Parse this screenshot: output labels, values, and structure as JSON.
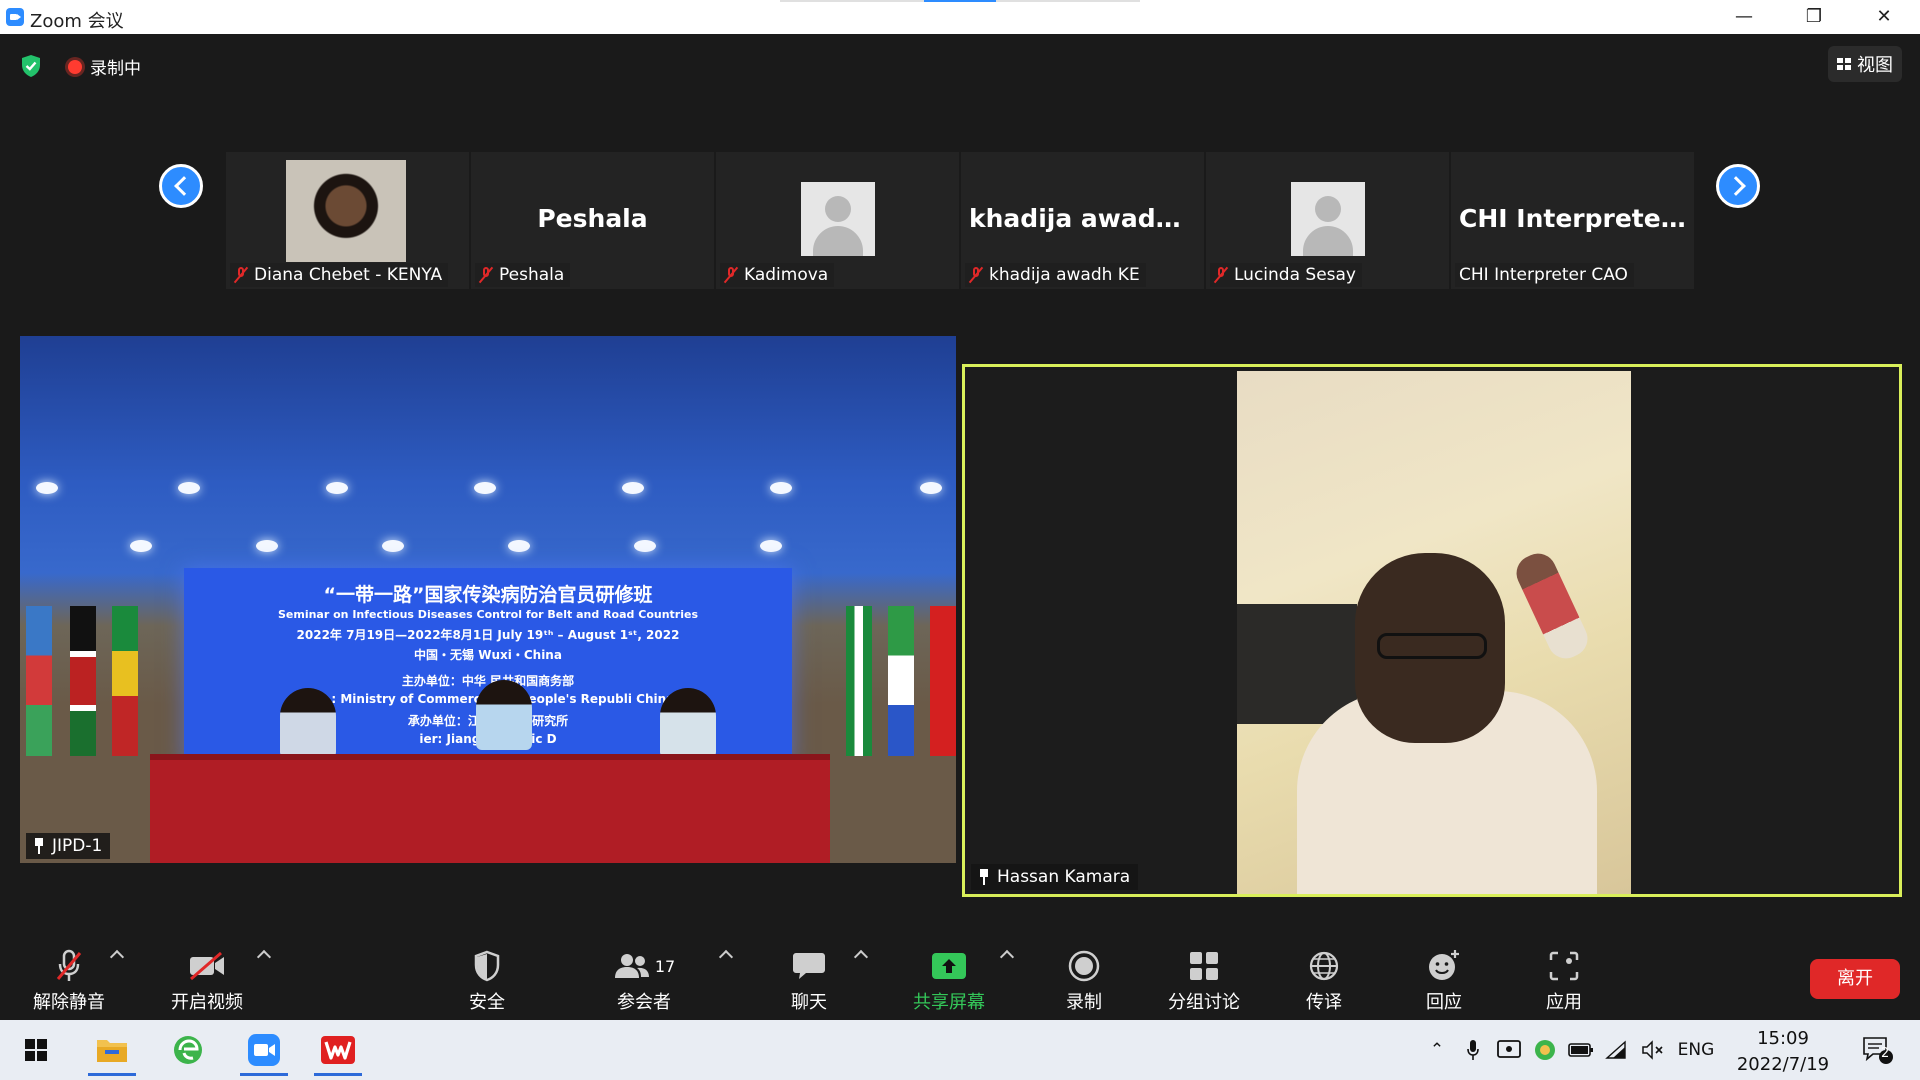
{
  "window": {
    "title": "Zoom 会议"
  },
  "status": {
    "recording_label": "录制中",
    "view_label": "视图"
  },
  "thumbnails": [
    {
      "big_name": "",
      "name": "Diana Chebet - KENYA",
      "muted": true,
      "avatar": "photo"
    },
    {
      "big_name": "Peshala",
      "name": "Peshala",
      "muted": true,
      "avatar": "none"
    },
    {
      "big_name": "",
      "name": "Kadimova",
      "muted": true,
      "avatar": "default"
    },
    {
      "big_name": "khadija awadh KE",
      "name": "khadija awadh KE",
      "muted": true,
      "avatar": "none"
    },
    {
      "big_name": "",
      "name": "Lucinda Sesay",
      "muted": true,
      "avatar": "default"
    },
    {
      "big_name": "CHI  Interpreter...",
      "name": "CHI Interpreter CAO",
      "muted": false,
      "avatar": "none"
    }
  ],
  "videos": {
    "left": {
      "name": "JIPD-1",
      "screen_lines": [
        "“一带一路”国家传染病防治官员研修班",
        "Seminar on Infectious Diseases Control for Belt and Road Countries",
        "2022年 7月19日—2022年8月1日 July  19ᵗʰ – August 1ˢᵗ, 2022",
        "中国・无锡  Wuxi・China",
        "主办单位：中华  民共和国商务部",
        "Spo   : Ministry of Commerce   the People's Republi   China",
        "承办单位：江苏            病防治研究所",
        "   ier:  Jiangsu         rasitic D"
      ]
    },
    "right": {
      "name": "Hassan Kamara"
    }
  },
  "toolbar": {
    "unmute": "解除静音",
    "start_video": "开启视频",
    "security": "安全",
    "participants": "参会者",
    "participants_count": "17",
    "chat": "聊天",
    "share_screen": "共享屏幕",
    "record": "录制",
    "breakout": "分组讨论",
    "translate": "传译",
    "reactions": "回应",
    "apps": "应用",
    "leave": "离开"
  },
  "taskbar": {
    "language": "ENG",
    "time": "15:09",
    "date": "2022/7/19",
    "notification_count": "2"
  },
  "colors": {
    "accent": "#2d8cff",
    "speaker_border": "#d9ef5a",
    "leave": "#e02828",
    "share_green": "#34c759"
  }
}
